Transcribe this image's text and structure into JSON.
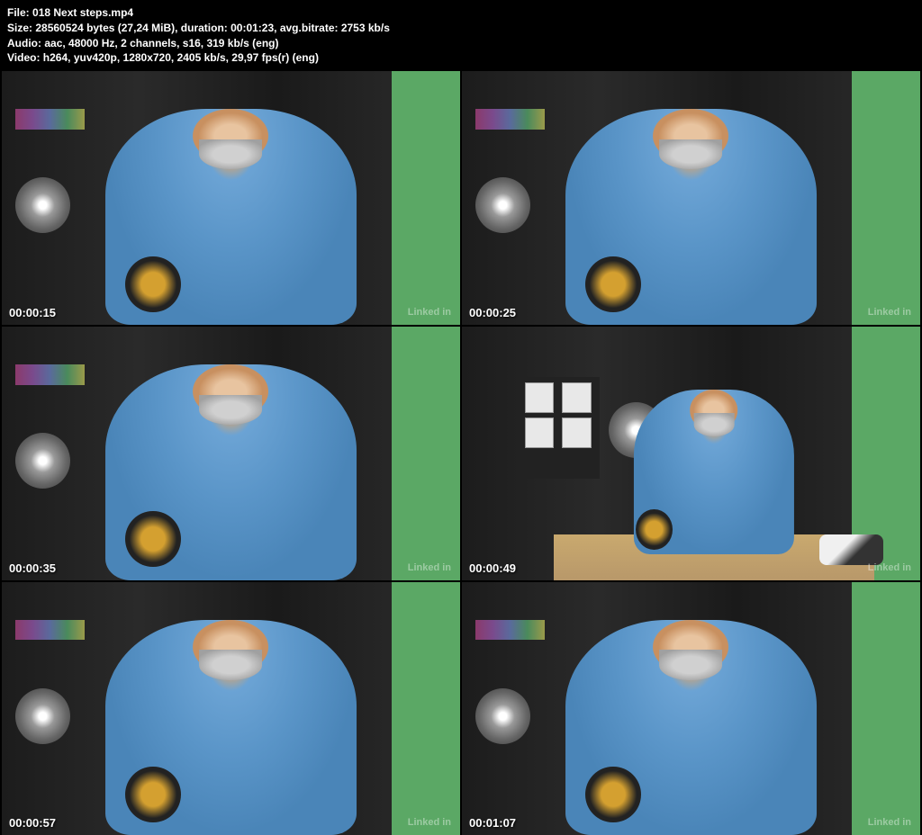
{
  "metadata": {
    "file_label": "File:",
    "file_value": "018 Next steps.mp4",
    "size_label": "Size:",
    "size_value": "28560524 bytes (27,24 MiB), duration: 00:01:23, avg.bitrate: 2753 kb/s",
    "audio_label": "Audio:",
    "audio_value": "aac, 48000 Hz, 2 channels, s16, 319 kb/s (eng)",
    "video_label": "Video:",
    "video_value": "h264, yuv420p, 1280x720, 2405 kb/s, 29,97 fps(r) (eng)"
  },
  "frames": [
    {
      "timestamp": "00:00:15",
      "watermark": "Linked in"
    },
    {
      "timestamp": "00:00:25",
      "watermark": "Linked in"
    },
    {
      "timestamp": "00:00:35",
      "watermark": "Linked in"
    },
    {
      "timestamp": "00:00:49",
      "watermark": "Linked in"
    },
    {
      "timestamp": "00:00:57",
      "watermark": "Linked in"
    },
    {
      "timestamp": "00:01:07",
      "watermark": "Linked in"
    }
  ]
}
